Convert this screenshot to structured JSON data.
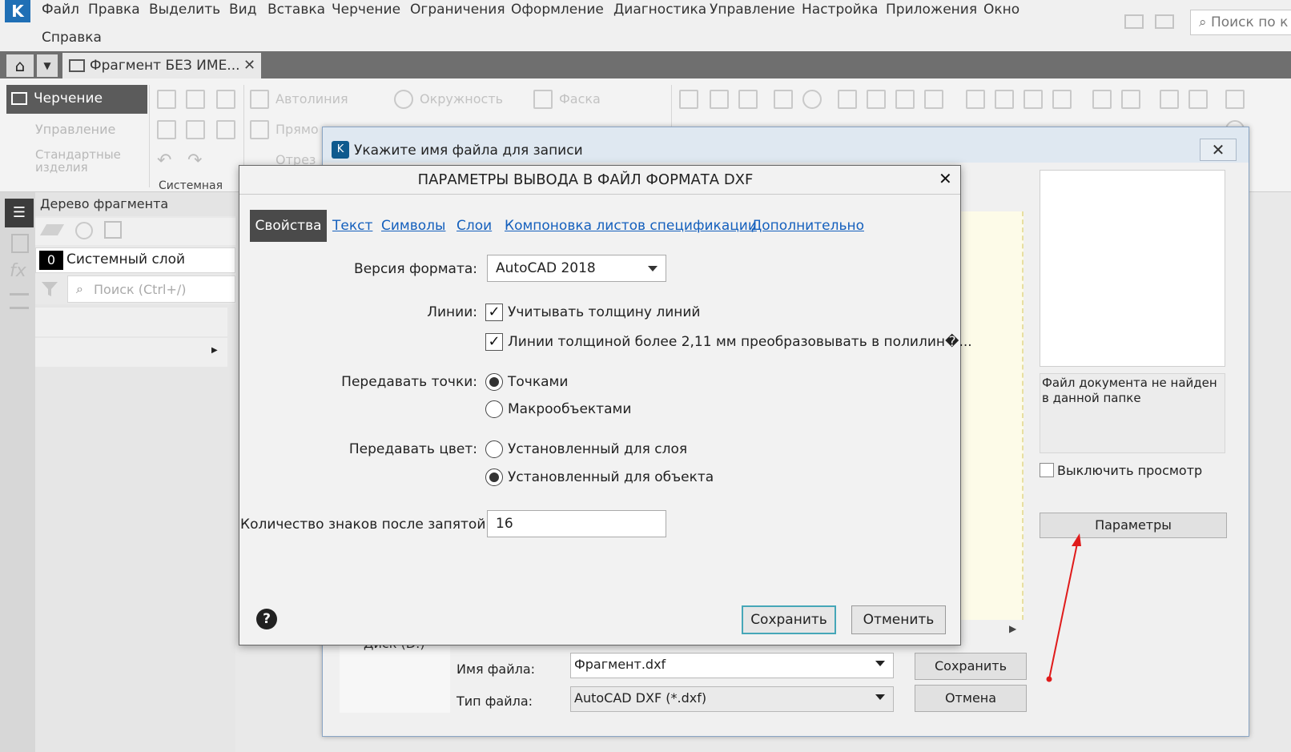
{
  "app": {
    "menu": [
      "Файл",
      "Правка",
      "Выделить",
      "Вид",
      "Вставка",
      "Черчение",
      "Ограничения",
      "Оформление",
      "Диагностика",
      "Управление",
      "Настройка",
      "Приложения",
      "Окно"
    ],
    "menu_second_row": "Справка",
    "search_placeholder": "Поиск по к"
  },
  "tabs": {
    "document_tab": "Фрагмент БЕЗ ИМЕ..."
  },
  "ribbon": {
    "left_nav": {
      "active": "Черчение",
      "items": [
        "Управление",
        "Стандартные",
        "изделия"
      ]
    },
    "tools": [
      "Автолиния",
      "Окружность",
      "Фаска",
      "Прямо",
      "Отрез"
    ],
    "group_label": "Системная"
  },
  "tree": {
    "header": "Дерево фрагмента",
    "layer_number": "0",
    "layer_name": "Системный слой",
    "search_placeholder": "Поиск (Ctrl+/)"
  },
  "save_dialog": {
    "title": "Укажите имя файла для записи",
    "preview_message": "Файл документа не найден в данной папке",
    "disable_preview_label": "Выключить просмотр",
    "params_button": "Параметры",
    "nav_disk": "Диск (D:)",
    "file_name_label": "Имя файла:",
    "file_name_value": "Фрагмент.dxf",
    "file_type_label": "Тип файла:",
    "file_type_value": "AutoCAD DXF (*.dxf)",
    "save_button": "Сохранить",
    "cancel_button": "Отмена"
  },
  "dxf_dialog": {
    "title": "ПАРАМЕТРЫ ВЫВОДА В ФАЙЛ ФОРМАТА DXF",
    "tabs": [
      "Свойства",
      "Текст",
      "Символы",
      "Слои",
      "Компоновка листов спецификации",
      "Дополнительно"
    ],
    "format_version_label": "Версия формата:",
    "format_version_value": "AutoCAD 2018",
    "lines_label": "Линии:",
    "lines_option_1": "Учитывать толщину линий",
    "lines_option_2": "Линии толщиной более 2,11 мм преобразовывать в полилин�...",
    "points_label": "Передавать точки:",
    "points_option_1": "Точками",
    "points_option_2": "Макрообъектами",
    "color_label": "Передавать цвет:",
    "color_option_1": "Установленный для слоя",
    "color_option_2": "Установленный для объекта",
    "decimals_label": "Количество знаков после запятой:",
    "decimals_value": "16",
    "save_button": "Сохранить",
    "cancel_button": "Отменить"
  },
  "colors": {
    "accent_link": "#1560bd",
    "active_tab": "#4a4a4a",
    "focus_border": "#46a7b8",
    "annotation_arrow": "#e01b1b"
  }
}
